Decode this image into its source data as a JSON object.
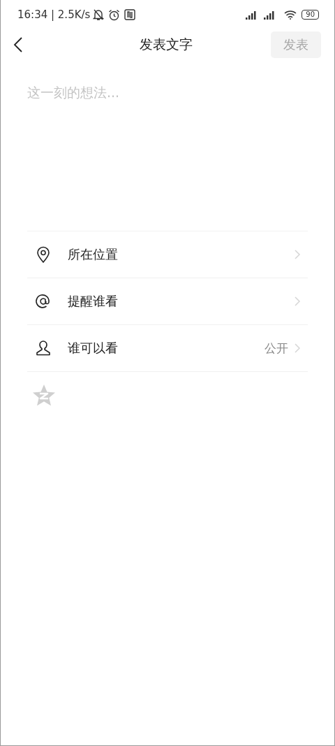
{
  "status_bar": {
    "time_speed": "16:34 | 2.5K/s",
    "battery": "90"
  },
  "header": {
    "title": "发表文字",
    "post_button": {
      "label": "发表",
      "disabled": true
    }
  },
  "editor": {
    "placeholder": "这一刻的想法..."
  },
  "options": [
    {
      "kind": "location",
      "label": "所在位置"
    },
    {
      "kind": "mention",
      "label": "提醒谁看"
    },
    {
      "kind": "visibility",
      "label": "谁可以看",
      "value": "公开"
    }
  ],
  "share_toggles": [
    {
      "kind": "qzone",
      "on": false
    }
  ]
}
